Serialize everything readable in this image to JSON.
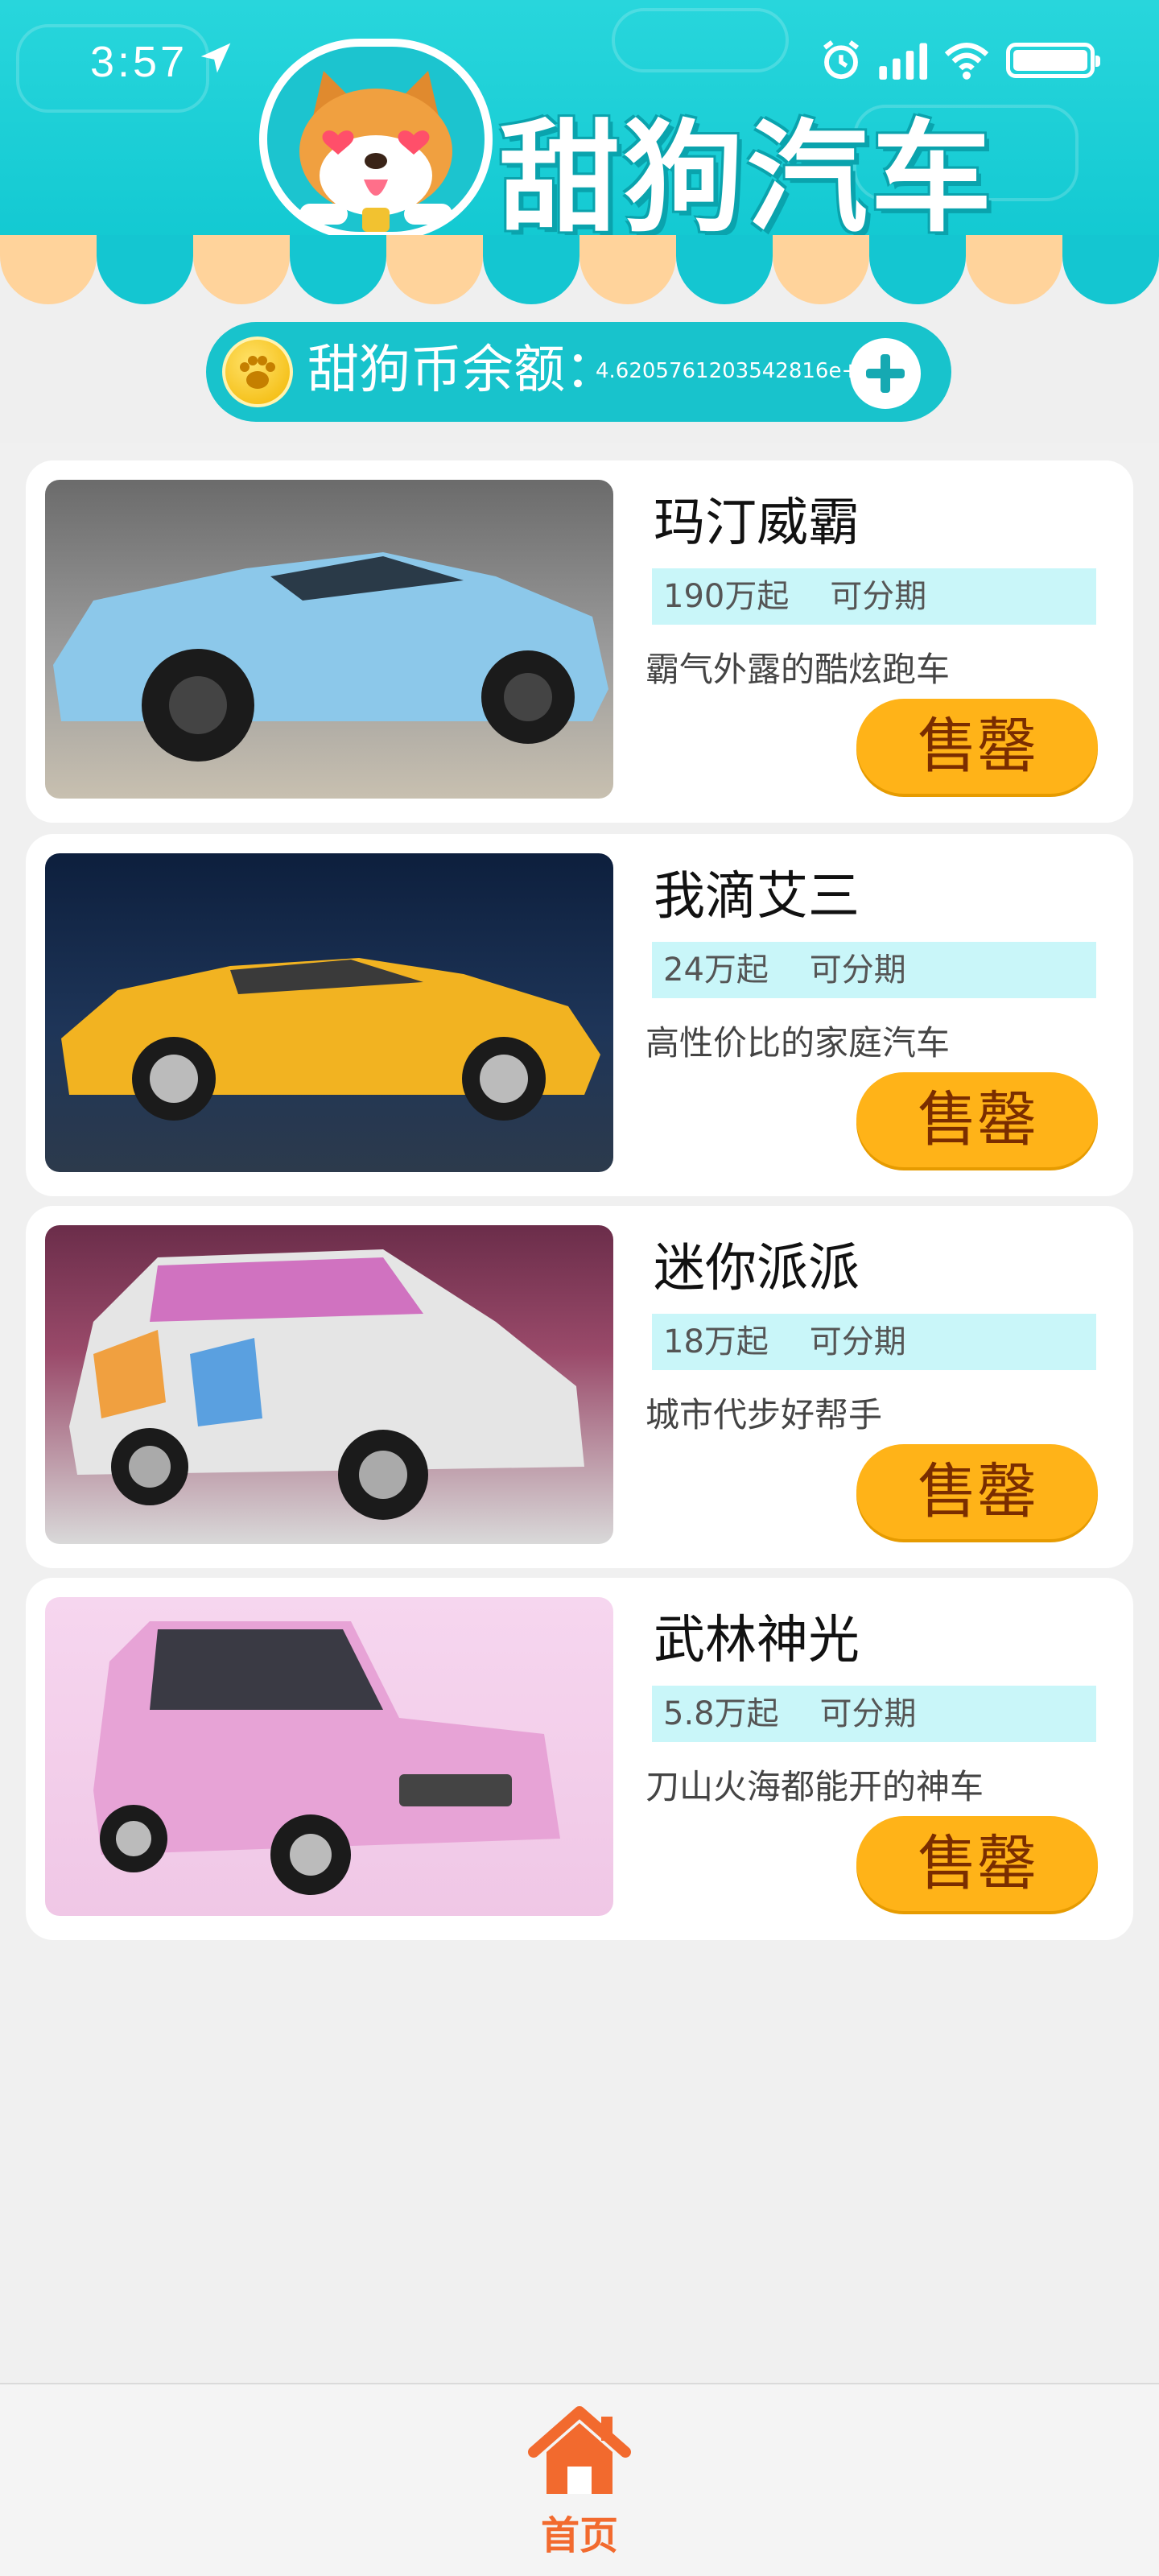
{
  "statusbar": {
    "time": "3:57"
  },
  "header": {
    "title": "甜狗汽车"
  },
  "balance": {
    "label": "甜狗币余额：",
    "value": "4.6205761203542816e+"
  },
  "cars": [
    {
      "name": "玛汀威霸",
      "price": "190万起",
      "installment": "可分期",
      "desc": "霸气外露的酷炫跑车",
      "button": "售罄",
      "color": "#8cc8ea"
    },
    {
      "name": "我滴艾三",
      "price": "24万起",
      "installment": "可分期",
      "desc": "高性价比的家庭汽车",
      "button": "售罄",
      "color": "#f2b321"
    },
    {
      "name": "迷你派派",
      "price": "18万起",
      "installment": "可分期",
      "desc": "城市代步好帮手",
      "button": "售罄",
      "color": "#e5e5e5"
    },
    {
      "name": "武林神光",
      "price": "5.8万起",
      "installment": "可分期",
      "desc": "刀山火海都能开的神车",
      "button": "售罄",
      "color": "#e7a3d6"
    }
  ],
  "nav": {
    "home_label": "首页"
  },
  "colors": {
    "primary": "#18c3cc",
    "button": "#ffb318",
    "accent": "#f26a2e"
  }
}
